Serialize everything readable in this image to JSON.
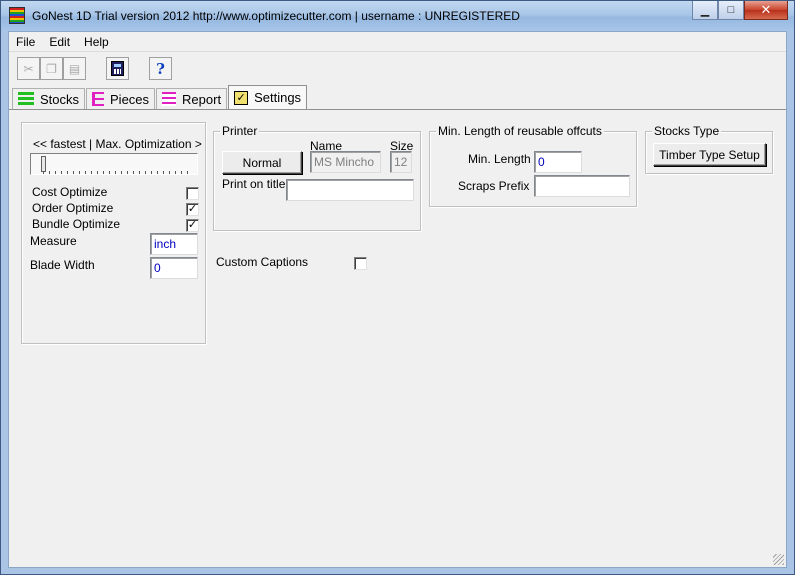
{
  "window": {
    "title": "GoNest 1D Trial version  2012  http://www.optimizecutter.com | username : UNREGISTERED"
  },
  "menu": [
    "File",
    "Edit",
    "Help"
  ],
  "toolbar": {
    "cut_icon": "scissors-icon",
    "copy_icon": "copy-icon",
    "paste_icon": "paste-icon",
    "calculator_icon": "calculator-icon",
    "help_label": "?"
  },
  "tabs": [
    {
      "label": "Stocks",
      "icon": "stocks-icon",
      "color": "#20c020"
    },
    {
      "label": "Pieces",
      "icon": "pieces-icon",
      "color": "#e020c0"
    },
    {
      "label": "Report",
      "icon": "report-icon",
      "color": "#e020c0"
    },
    {
      "label": "Settings",
      "icon": "settings-icon",
      "active": true
    }
  ],
  "optimization": {
    "slider_label": "<< fastest  |  Max.  Optimization >",
    "slider_value": 0,
    "cost_optimize": {
      "label": "Cost Optimize",
      "checked": false
    },
    "order_optimize": {
      "label": "Order Optimize",
      "checked": true
    },
    "bundle_optimize": {
      "label": "Bundle Optimize",
      "checked": true
    },
    "measure_label": "Measure",
    "measure_value": "inch",
    "blade_width_label": "Blade Width",
    "blade_width_value": "0"
  },
  "printer": {
    "title": "Printer",
    "name_header": "Name",
    "size_header": "Size",
    "normal_button": "Normal",
    "font_name": "MS Mincho",
    "font_size": "12",
    "print_on_title_label": "Print on title",
    "print_on_title_value": ""
  },
  "custom_captions": {
    "label": "Custom Captions",
    "checked": false
  },
  "offcuts": {
    "title": "Min. Length of reusable offcuts",
    "min_length_label": "Min. Length",
    "min_length_value": "0",
    "scraps_prefix_label": "Scraps Prefix",
    "scraps_prefix_value": ""
  },
  "stocks_type": {
    "title": "Stocks Type",
    "button": "Timber Type Setup"
  },
  "check_mark": "✓"
}
